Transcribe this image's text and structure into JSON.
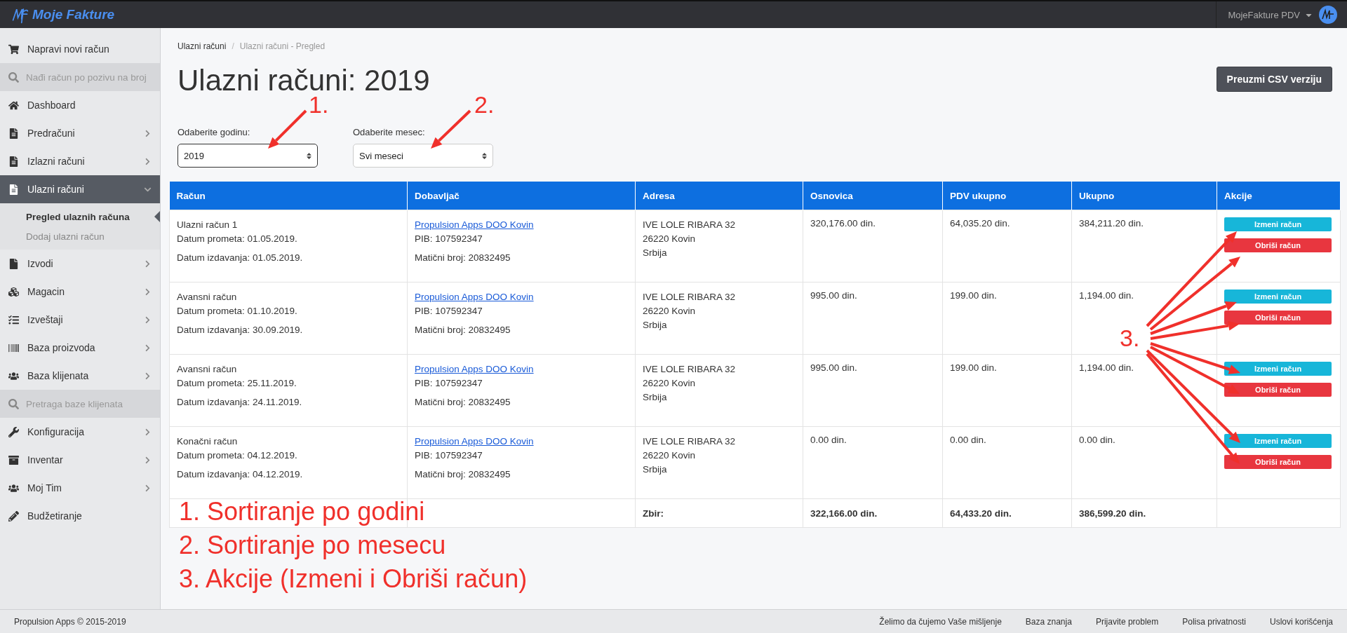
{
  "topbar": {
    "brand": "Moje Fakture",
    "account": "MojeFakture PDV"
  },
  "sidebar": {
    "items": [
      {
        "kind": "action",
        "label": "Napravi novi račun"
      },
      {
        "kind": "search",
        "placeholder": "Nađi račun po pozivu na broj"
      },
      {
        "kind": "link",
        "label": "Dashboard"
      },
      {
        "kind": "menu",
        "label": "Predračuni",
        "expanded": false
      },
      {
        "kind": "menu",
        "label": "Izlazni računi",
        "expanded": false
      },
      {
        "kind": "menu",
        "label": "Ulazni računi",
        "expanded": true,
        "children": [
          {
            "label": "Pregled ulaznih računa",
            "selected": true
          },
          {
            "label": "Dodaj ulazni račun",
            "selected": false
          }
        ]
      },
      {
        "kind": "menu",
        "label": "Izvodi",
        "expanded": false
      },
      {
        "kind": "menu",
        "label": "Magacin",
        "expanded": false
      },
      {
        "kind": "menu",
        "label": "Izveštaji",
        "expanded": false
      },
      {
        "kind": "menu",
        "label": "Baza proizvoda",
        "expanded": false
      },
      {
        "kind": "menu",
        "label": "Baza klijenata",
        "expanded": false
      },
      {
        "kind": "search",
        "placeholder": "Pretraga baze klijenata"
      },
      {
        "kind": "menu",
        "label": "Konfiguracija",
        "expanded": false
      },
      {
        "kind": "menu",
        "label": "Inventar",
        "expanded": false
      },
      {
        "kind": "menu",
        "label": "Moj Tim",
        "expanded": false
      },
      {
        "kind": "link",
        "label": "Budžetiranje"
      }
    ]
  },
  "breadcrumb": {
    "separator": "/",
    "items": [
      {
        "label": "Ulazni računi",
        "current": false
      },
      {
        "label": "Ulazni računi - Pregled",
        "current": true
      }
    ]
  },
  "page_title": "Ulazni računi: 2019",
  "csv_button": "Preuzmi CSV verziju",
  "filters": [
    {
      "label": "Odaberite godinu:",
      "value": "2019",
      "focused": true
    },
    {
      "label": "Odaberite mesec:",
      "value": "Svi meseci",
      "focused": false
    }
  ],
  "table": {
    "columns": [
      "Račun",
      "Dobavljač",
      "Adresa",
      "Osnovica",
      "PDV ukupno",
      "Ukupno",
      "Akcije"
    ],
    "rows": [
      {
        "invoice": {
          "title": "Ulazni račun 1",
          "turnover_date": "Datum prometa: 01.05.2019.",
          "issue_date": "Datum izdavanja: 01.05.2019."
        },
        "supplier": {
          "name": "Propulsion Apps DOO Kovin",
          "pib": "PIB: 107592347",
          "reg_no": "Matični broj: 20832495"
        },
        "address": [
          "IVE LOLE RIBARA 32",
          "26220 Kovin",
          "Srbija"
        ],
        "base": "320,176.00 din.",
        "vat": "64,035.20 din.",
        "total": "384,211.20 din.",
        "actions": [
          {
            "kind": "edit",
            "label": "Izmeni račun"
          },
          {
            "kind": "delete",
            "label": "Obriši račun"
          }
        ]
      },
      {
        "invoice": {
          "title": "Avansni račun",
          "turnover_date": "Datum prometa: 01.10.2019.",
          "issue_date": "Datum izdavanja: 30.09.2019."
        },
        "supplier": {
          "name": "Propulsion Apps DOO Kovin",
          "pib": "PIB: 107592347",
          "reg_no": "Matični broj: 20832495"
        },
        "address": [
          "IVE LOLE RIBARA 32",
          "26220 Kovin",
          "Srbija"
        ],
        "base": "995.00 din.",
        "vat": "199.00 din.",
        "total": "1,194.00 din.",
        "actions": [
          {
            "kind": "edit",
            "label": "Izmeni račun"
          },
          {
            "kind": "delete",
            "label": "Obriši račun"
          }
        ]
      },
      {
        "invoice": {
          "title": "Avansni račun",
          "turnover_date": "Datum prometa: 25.11.2019.",
          "issue_date": "Datum izdavanja: 24.11.2019."
        },
        "supplier": {
          "name": "Propulsion Apps DOO Kovin",
          "pib": "PIB: 107592347",
          "reg_no": "Matični broj: 20832495"
        },
        "address": [
          "IVE LOLE RIBARA 32",
          "26220 Kovin",
          "Srbija"
        ],
        "base": "995.00 din.",
        "vat": "199.00 din.",
        "total": "1,194.00 din.",
        "actions": [
          {
            "kind": "edit",
            "label": "Izmeni račun"
          },
          {
            "kind": "delete",
            "label": "Obriši račun"
          }
        ]
      },
      {
        "invoice": {
          "title": "Konačni račun",
          "turnover_date": "Datum prometa: 04.12.2019.",
          "issue_date": "Datum izdavanja: 04.12.2019."
        },
        "supplier": {
          "name": "Propulsion Apps DOO Kovin",
          "pib": "PIB: 107592347",
          "reg_no": "Matični broj: 20832495"
        },
        "address": [
          "IVE LOLE RIBARA 32",
          "26220 Kovin",
          "Srbija"
        ],
        "base": "0.00 din.",
        "vat": "0.00 din.",
        "total": "0.00 din.",
        "actions": [
          {
            "kind": "edit",
            "label": "Izmeni račun"
          },
          {
            "kind": "delete",
            "label": "Obriši račun"
          }
        ]
      }
    ],
    "totals": {
      "label": "Zbir:",
      "base": "322,166.00 din.",
      "vat": "64,433.20 din.",
      "total": "386,599.20 din."
    }
  },
  "annotations": {
    "markers": [
      "1.",
      "2.",
      "3."
    ],
    "notes": [
      "1. Sortiranje po godini",
      "2. Sortiranje po mesecu",
      "3. Akcije (Izmeni i Obriši račun)"
    ]
  },
  "footer": {
    "copyright": "Propulsion Apps © 2015-2019",
    "links": [
      "Želimo da čujemo Vaše mišljenje",
      "Baza znanja",
      "Prijavite problem",
      "Polisa privatnosti",
      "Uslovi korišćenja"
    ]
  }
}
